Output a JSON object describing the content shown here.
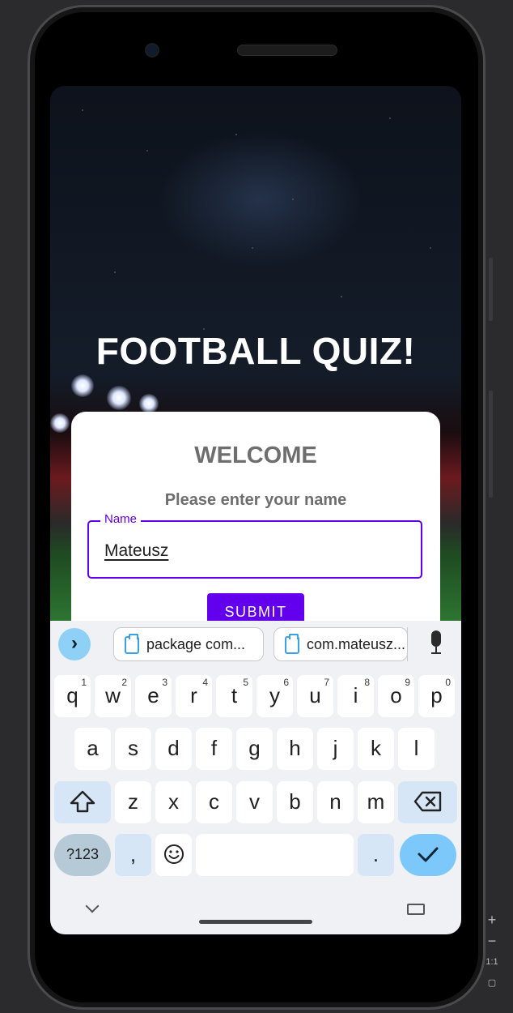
{
  "app": {
    "title": "FOOTBALL QUIZ!",
    "card": {
      "heading": "WELCOME",
      "prompt": "Please enter your name",
      "name_field": {
        "label": "Name",
        "value": "Mateusz"
      },
      "submit_label": "SUBMIT"
    }
  },
  "keyboard": {
    "suggestions": [
      "package com...",
      "com.mateusz..."
    ],
    "row1": [
      {
        "key": "q",
        "hint": "1"
      },
      {
        "key": "w",
        "hint": "2"
      },
      {
        "key": "e",
        "hint": "3"
      },
      {
        "key": "r",
        "hint": "4"
      },
      {
        "key": "t",
        "hint": "5"
      },
      {
        "key": "y",
        "hint": "6"
      },
      {
        "key": "u",
        "hint": "7"
      },
      {
        "key": "i",
        "hint": "8"
      },
      {
        "key": "o",
        "hint": "9"
      },
      {
        "key": "p",
        "hint": "0"
      }
    ],
    "row2": [
      "a",
      "s",
      "d",
      "f",
      "g",
      "h",
      "j",
      "k",
      "l"
    ],
    "row3": [
      "z",
      "x",
      "c",
      "v",
      "b",
      "n",
      "m"
    ],
    "row4": {
      "symbols": "?123",
      "comma": ",",
      "period": "."
    }
  },
  "emulator_controls": {
    "plus": "+",
    "minus": "−",
    "ratio": "1:1"
  },
  "colors": {
    "accent": "#6200ee",
    "enter_key": "#7cc8fa",
    "shift_key": "#d6e6f6"
  }
}
